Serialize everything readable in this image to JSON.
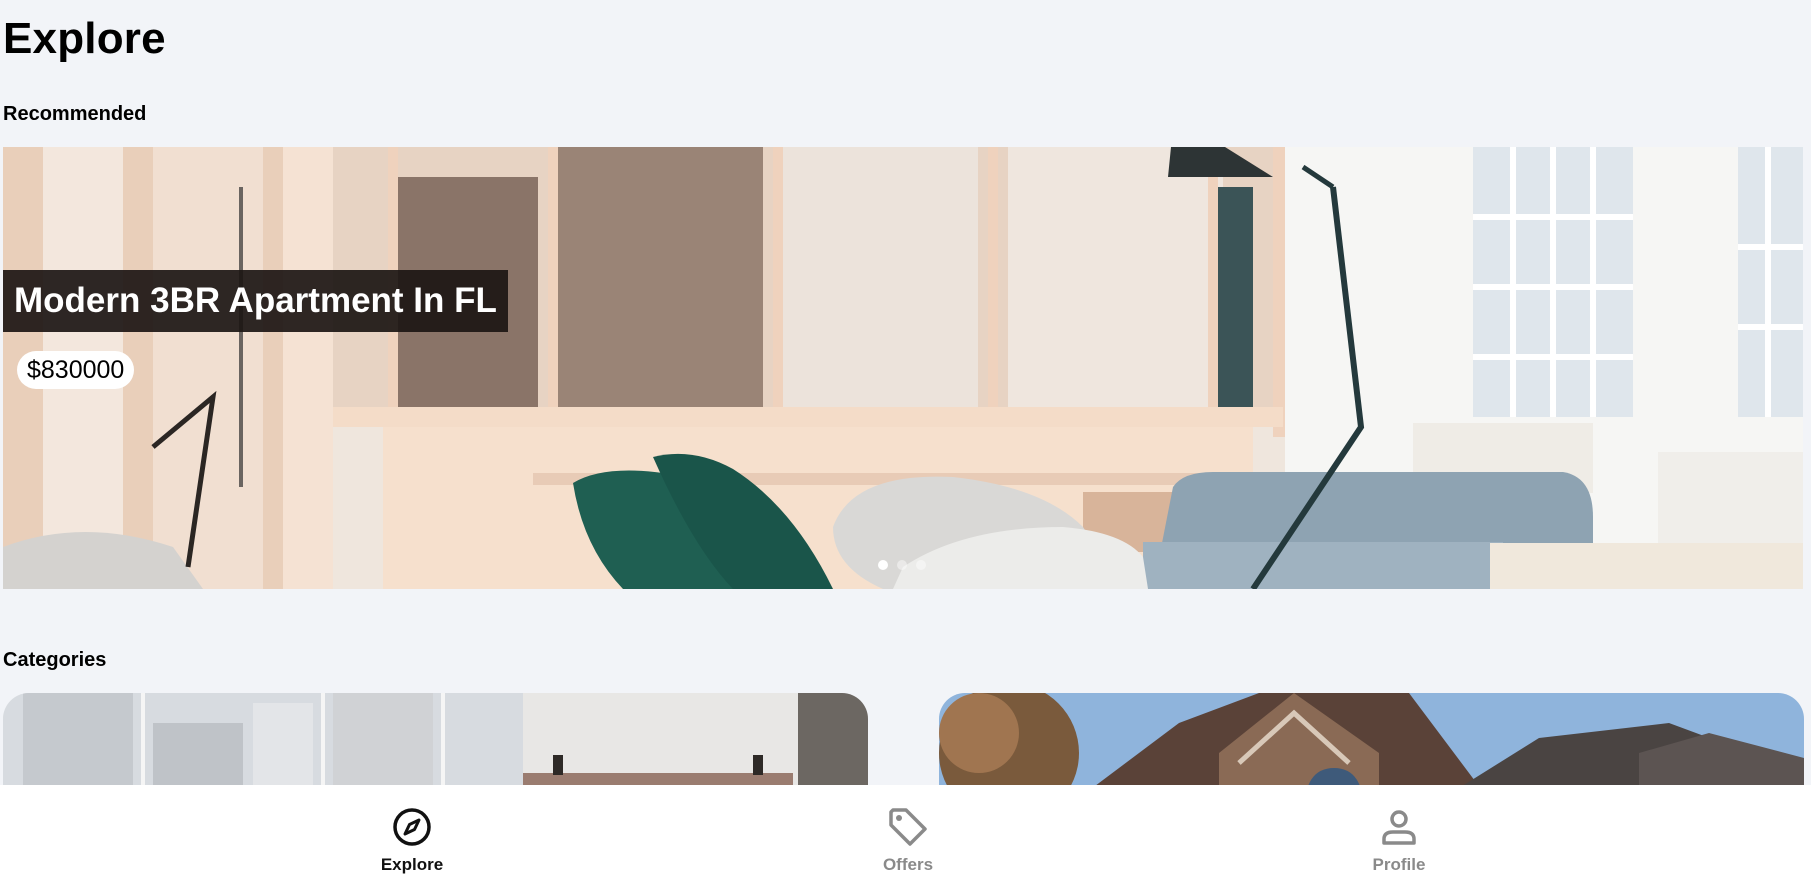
{
  "header": {
    "title": "Explore"
  },
  "sections": {
    "recommended": "Recommended",
    "categories": "Categories"
  },
  "carousel": {
    "listing_title": "Modern 3BR Apartment In FL",
    "price": "$830000",
    "slide_count": 3,
    "active_slide": 1
  },
  "nav": {
    "items": [
      {
        "label": "Explore",
        "icon": "compass-icon",
        "active": true
      },
      {
        "label": "Offers",
        "icon": "tag-icon",
        "active": false
      },
      {
        "label": "Profile",
        "icon": "person-icon",
        "active": false
      }
    ]
  },
  "colors": {
    "background": "#f2f4f8",
    "active_nav": "#111111",
    "inactive_nav": "#8a8a8a",
    "title_overlay": "#1c1614"
  }
}
